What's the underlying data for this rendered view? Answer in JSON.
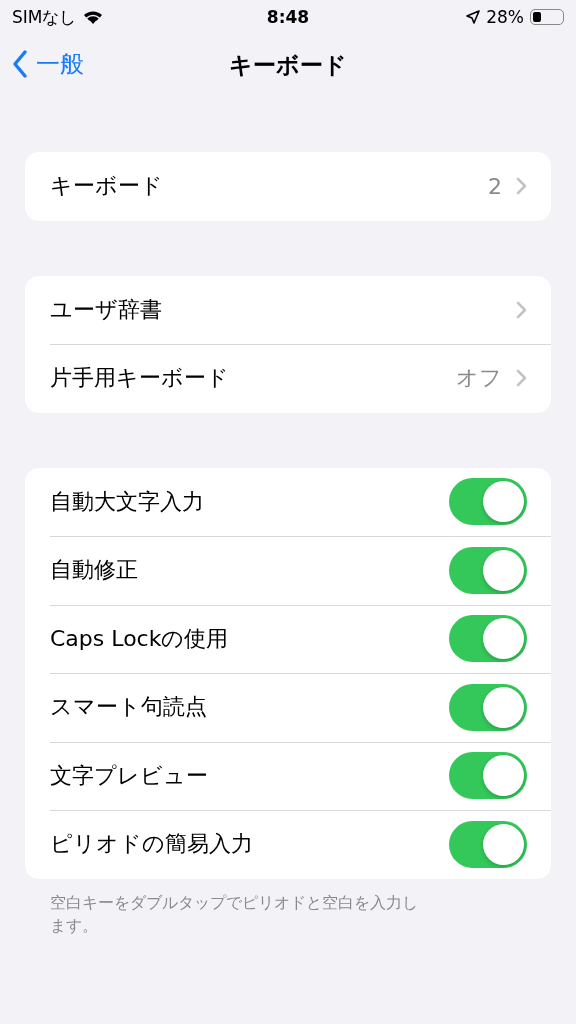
{
  "status_bar": {
    "carrier": "SIMなし",
    "time": "8:48",
    "battery": "28%"
  },
  "nav": {
    "back": "一般",
    "title": "キーボード"
  },
  "groups": [
    {
      "rows": [
        {
          "kind": "link",
          "label": "キーボード",
          "value": "2"
        }
      ]
    },
    {
      "rows": [
        {
          "kind": "link",
          "label": "ユーザ辞書"
        },
        {
          "kind": "link",
          "label": "片手用キーボード",
          "value": "オフ"
        }
      ]
    },
    {
      "rows": [
        {
          "kind": "toggle",
          "label": "自動大文字入力",
          "on": true
        },
        {
          "kind": "toggle",
          "label": "自動修正",
          "on": true
        },
        {
          "kind": "toggle",
          "label": "Caps Lockの使用",
          "on": true
        },
        {
          "kind": "toggle",
          "label": "スマート句読点",
          "on": true
        },
        {
          "kind": "toggle",
          "label": "文字プレビュー",
          "on": true
        },
        {
          "kind": "toggle",
          "label": "ピリオドの簡易入力",
          "on": true
        }
      ],
      "footer": "空白キーをダブルタップでピリオドと空白を入力します。"
    }
  ]
}
